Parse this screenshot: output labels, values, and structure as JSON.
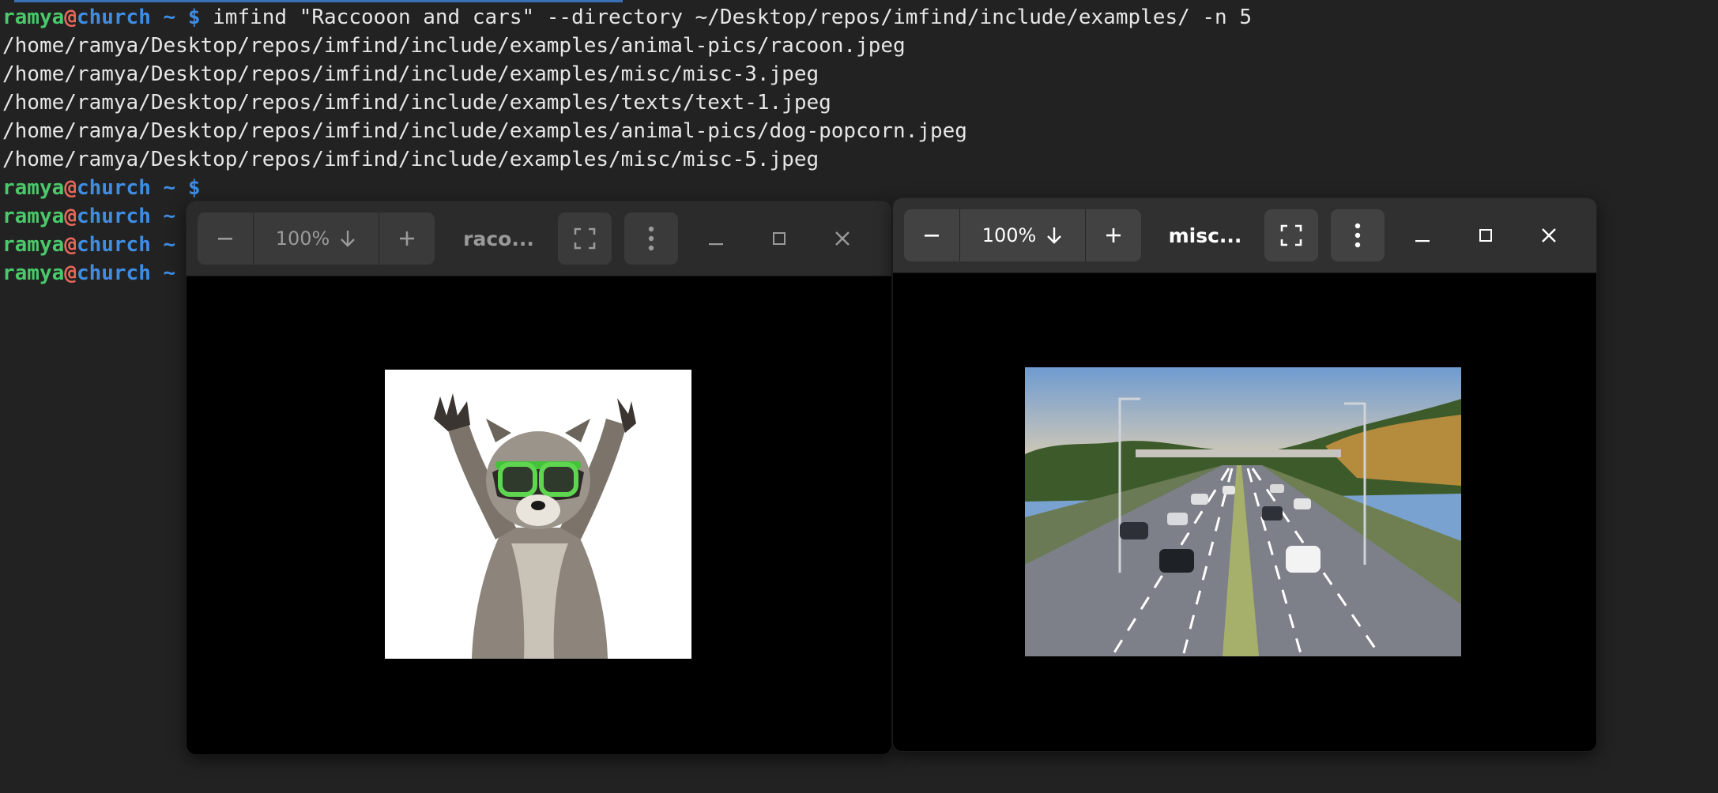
{
  "terminal": {
    "user": "ramya",
    "at": "@",
    "host": "church",
    "path": "~",
    "prompt_symbol": "$",
    "command": "imfind \"Raccooon and cars\" --directory ~/Desktop/repos/imfind/include/examples/ -n 5",
    "results": [
      "/home/ramya/Desktop/repos/imfind/include/examples/animal-pics/racoon.jpeg",
      "/home/ramya/Desktop/repos/imfind/include/examples/misc/misc-3.jpeg",
      "/home/ramya/Desktop/repos/imfind/include/examples/texts/text-1.jpeg",
      "/home/ramya/Desktop/repos/imfind/include/examples/animal-pics/dog-popcorn.jpeg",
      "/home/ramya/Desktop/repos/imfind/include/examples/misc/misc-5.jpeg"
    ]
  },
  "viewers": [
    {
      "zoom": "100%",
      "title": "raco...",
      "state": "inactive",
      "image": "raccoon with green sunglasses raising paws"
    },
    {
      "zoom": "100%",
      "title": "misc...",
      "state": "active",
      "image": "highway with cars and street lamps"
    }
  ],
  "icons": {
    "zoom_out": "minus-icon",
    "zoom_dropdown": "arrow-down-icon",
    "zoom_in": "plus-icon",
    "fullscreen": "fullscreen-icon",
    "menu": "kebab-menu-icon",
    "minimize": "minimize-icon",
    "maximize": "maximize-icon",
    "close": "close-icon"
  },
  "colors": {
    "terminal_bg": "#222222",
    "user": "#4ac96a",
    "at": "#e8685a",
    "host": "#3f8de3",
    "text": "#e6e6e6"
  }
}
